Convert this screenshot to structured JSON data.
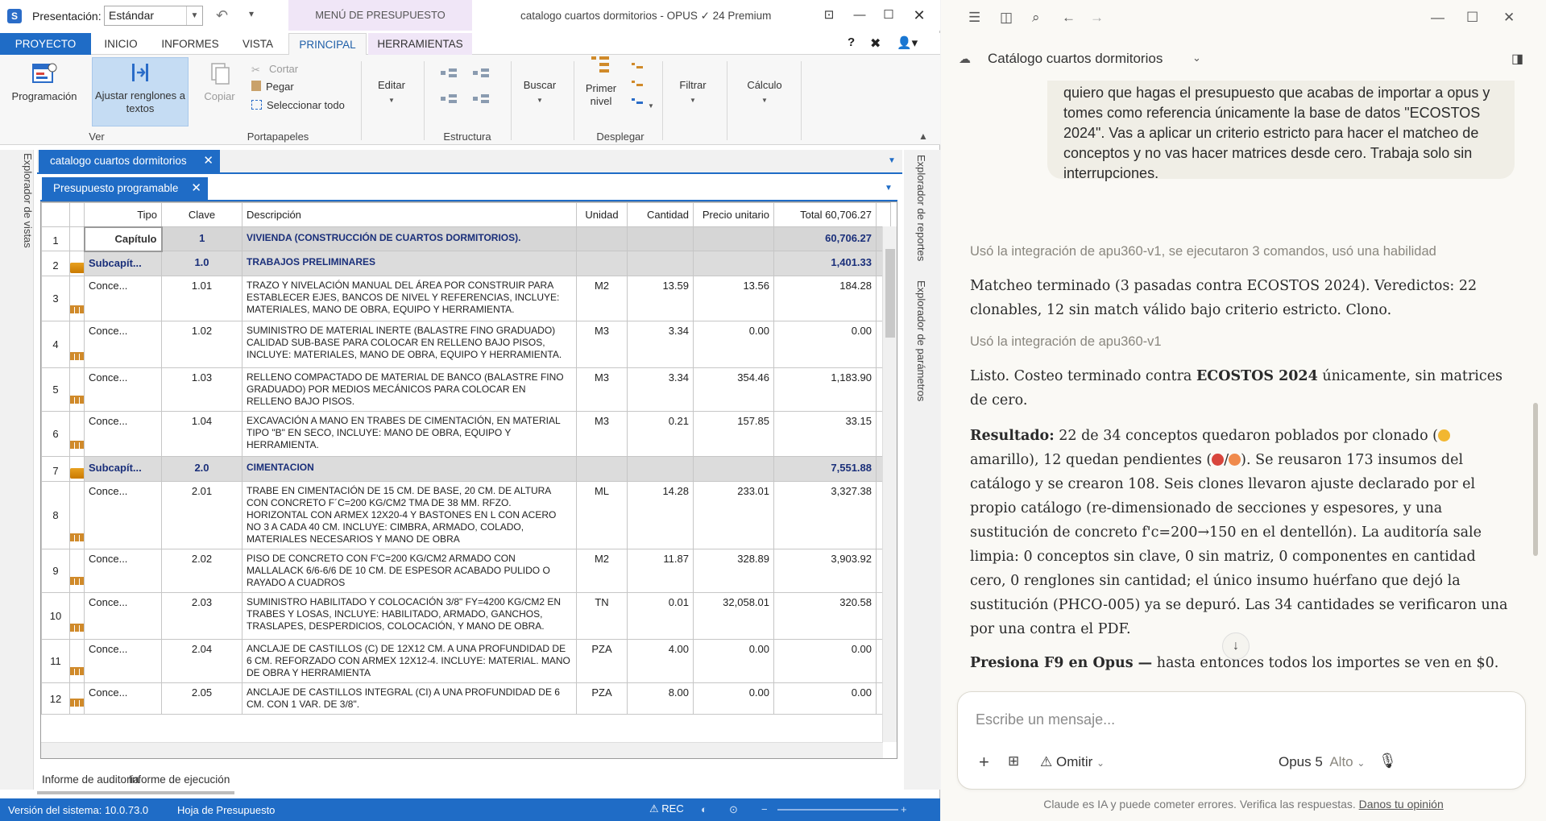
{
  "opus": {
    "presentacion_label": "Presentación:",
    "presentacion_value": "Estándar",
    "menu_presupuesto": "MENÚ DE PRESUPUESTO",
    "window_title": "catalogo cuartos dormitorios - OPUS ✓ 24 Premium",
    "menu_tabs": [
      "PROYECTO",
      "INICIO",
      "INFORMES",
      "VISTA",
      "PRINCIPAL",
      "HERRAMIENTAS"
    ],
    "help": "?",
    "ribbon": {
      "programacion": "Programación",
      "ajustar": "Ajustar renglones a textos",
      "copiar": "Copiar",
      "cortar": "Cortar",
      "pegar": "Pegar",
      "seleccionar_todo": "Seleccionar todo",
      "editar": "Editar",
      "buscar": "Buscar",
      "primer_nivel": "Primer nivel",
      "filtrar": "Filtrar",
      "calculo": "Cálculo",
      "groups": {
        "ver": "Ver",
        "portapapeles": "Portapapeles",
        "estructura": "Estructura",
        "desplegar": "Desplegar"
      }
    },
    "left_explorer": "Explorador de vistas",
    "right_explorer_1": "Explorador de reportes",
    "right_explorer_2": "Explorador de parámetros",
    "doc_tab": "catalogo cuartos dormitorios",
    "sub_tab": "Presupuesto programable",
    "columns": [
      "Tipo",
      "Clave",
      "Descripción",
      "Unidad",
      "Cantidad",
      "Precio unitario",
      "Total 60,706.27"
    ],
    "rows": [
      {
        "n": "1",
        "tipo": "Capítulo",
        "clave": "1",
        "desc": "VIVIENDA (CONSTRUCCIÓN DE CUARTOS DORMITORIOS).",
        "unidad": "",
        "cantidad": "",
        "precio": "",
        "total": "60,706.27"
      },
      {
        "n": "2",
        "tipo": "Subcapít...",
        "clave": "1.0",
        "desc": "TRABAJOS PRELIMINARES",
        "unidad": "",
        "cantidad": "",
        "precio": "",
        "total": "1,401.33"
      },
      {
        "n": "3",
        "tipo": "Conce...",
        "clave": "1.01",
        "desc": "TRAZO Y NIVELACIÓN MANUAL DEL ÁREA POR CONSTRUIR PARA ESTABLECER EJES, BANCOS DE NIVEL Y REFERENCIAS, INCLUYE: MATERIALES, MANO DE OBRA, EQUIPO Y HERRAMIENTA.",
        "unidad": "M2",
        "cantidad": "13.59",
        "precio": "13.56",
        "total": "184.28"
      },
      {
        "n": "4",
        "tipo": "Conce...",
        "clave": "1.02",
        "desc": "SUMINISTRO DE MATERIAL INERTE (balastre fino graduado) CALIDAD SUB-BASE PARA COLOCAR EN RELLENO BAJO PISOS, INCLUYE: MATERIALES, MANO DE OBRA, EQUIPO Y HERRAMIENTA.",
        "unidad": "M3",
        "cantidad": "3.34",
        "precio": "0.00",
        "total": "0.00"
      },
      {
        "n": "5",
        "tipo": "Conce...",
        "clave": "1.03",
        "desc": "RELLENO COMPACTADO DE MATERIAL DE BANCO (BALASTRE FINO GRADUADO) POR MEDIOS MECÁNICOS PARA COLOCAR EN RELLENO BAJO PISOS.",
        "unidad": "M3",
        "cantidad": "3.34",
        "precio": "354.46",
        "total": "1,183.90"
      },
      {
        "n": "6",
        "tipo": "Conce...",
        "clave": "1.04",
        "desc": "EXCAVACIÓN A MANO EN TRABES DE CIMENTACIÓN, EN MATERIAL TIPO \"B\" EN SECO, INCLUYE: MANO DE OBRA, EQUIPO Y HERRAMIENTA.",
        "unidad": "M3",
        "cantidad": "0.21",
        "precio": "157.85",
        "total": "33.15"
      },
      {
        "n": "7",
        "tipo": "Subcapít...",
        "clave": "2.0",
        "desc": "CIMENTACION",
        "unidad": "",
        "cantidad": "",
        "precio": "",
        "total": "7,551.88"
      },
      {
        "n": "8",
        "tipo": "Conce...",
        "clave": "2.01",
        "desc": "TRABE EN CIMENTACIÓN DE 15 CM. DE BASE, 20 CM. DE ALTURA CON CONCRETO F´C=200 kg/cm2 tma de 38 mm. RFZO. HORIZONTAL CON ARMEX 12X20-4 Y BASTONES EN L CON ACERO No 3 A CADA 40 CM. INCLUYE: CIMBRA, ARMADO, COLADO, MATERIALES NECESARIOS Y MANO DE OBRA",
        "unidad": "ML",
        "cantidad": "14.28",
        "precio": "233.01",
        "total": "3,327.38"
      },
      {
        "n": "9",
        "tipo": "Conce...",
        "clave": "2.02",
        "desc": "PISO DE CONCRETO CON F'C=200 KG/CM2 ARMADO CON MALLALACK 6/6-6/6 DE 10 CM. DE ESPESOR ACABADO PULIDO O RAYADO A CUADROS",
        "unidad": "M2",
        "cantidad": "11.87",
        "precio": "328.89",
        "total": "3,903.92"
      },
      {
        "n": "10",
        "tipo": "Conce...",
        "clave": "2.03",
        "desc": "SUMINISTRO HABILITADO Y COLOCACIÓN 3/8\" FY=4200 KG/CM2 EN TRABES Y LOSAS, INCLUYE: HABILITADO, ARMADO, GANCHOS, TRASLAPES, DESPERDICIOS, COLOCACIÓN, Y MANO DE OBRA.",
        "unidad": "TN",
        "cantidad": "0.01",
        "precio": "32,058.01",
        "total": "320.58"
      },
      {
        "n": "11",
        "tipo": "Conce...",
        "clave": "2.04",
        "desc": "ANCLAJE DE CASTILLOS (C) DE 12X12 CM. A UNA PROFUNDIDAD DE 6 CM. REFORZADO CON ARMEX 12X12-4. INCLUYE: MATERIAL. MANO DE OBRA Y HERRAMIENTA",
        "unidad": "PZA",
        "cantidad": "4.00",
        "precio": "0.00",
        "total": "0.00"
      },
      {
        "n": "12",
        "tipo": "Conce...",
        "clave": "2.05",
        "desc": "ANCLAJE DE CASTILLOS INTEGRAL (CI) A UNA PROFUNDIDAD DE 6 CM. CON 1 VAR. DE 3/8\".",
        "unidad": "PZA",
        "cantidad": "8.00",
        "precio": "0.00",
        "total": "0.00"
      }
    ],
    "bottom_tabs": [
      "Informe de auditoría",
      "Informe de ejecución"
    ],
    "status": {
      "version": "Versión del sistema: 10.0.73.0",
      "sheet": "Hoja de Presupuesto",
      "rec": "⚠ REC"
    }
  },
  "claude": {
    "title": "Catálogo cuartos dormitorios",
    "user_message": "quiero que hagas el presupuesto que acabas de importar a opus y tomes como referencia únicamente la base de datos \"ECOSTOS 2024\". Vas a aplicar un criterio estricto para hacer el matcheo de conceptos y no vas hacer matrices desde cero. Trabaja solo sin interrupciones.",
    "note_1": "Usó la integración de apu360-v1, se ejecutaron 3 comandos, usó una habilidad",
    "para_1": "Matcheo terminado (3 pasadas contra ECOSTOS 2024). Veredictos: 22 clonables, 12 sin match válido bajo criterio estricto. Clono.",
    "note_2": "Usó la integración de apu360-v1",
    "para_2a": "Listo. Costeo terminado contra ",
    "para_2b": "ECOSTOS 2024",
    "para_2c": " únicamente, sin matrices de cero.",
    "result_label": "Resultado:",
    "result_1": " 22 de 34 conceptos quedaron poblados por clonado (",
    "result_2": " amarillo), 12 quedan pendientes (",
    "result_3": "). Se reusaron 173 insumos del catálogo y se crearon 108. Seis clones llevaron ajuste declarado por el propio catálogo (re-dimensionado de secciones y espesores, y una sustitución de concreto f'c=200→150 en el dentellón). La auditoría sale limpia: 0 conceptos sin clave, 0 sin matriz, 0 componentes en cantidad cero, 0 renglones sin cantidad; el único insumo huérfano que dejó la sustitución (PHCO-005) ya se depuró. Las 34 cantidades se verificaron una por una contra el PDF.",
    "f9_bold": "Presiona F9 en Opus —",
    "f9_rest": " hasta entonces todos los importes se ven en $0.",
    "input_placeholder": "Escribe un mensaje...",
    "omit": "Omitir",
    "model": "Opus 5",
    "level": "Alto",
    "footer": "Claude es IA y puede cometer errores. Verifica las respuestas.",
    "footer_link": "Danos tu opinión",
    "colors": {
      "yellow": "#f2b731",
      "red": "#d8453c",
      "orange": "#f08a4b"
    }
  }
}
